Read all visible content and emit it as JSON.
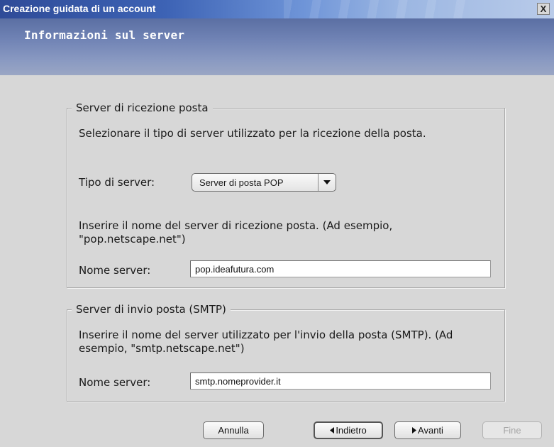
{
  "window": {
    "title": "Creazione guidata di un account",
    "close_label": "X"
  },
  "header": {
    "title": "Informazioni sul server"
  },
  "incoming": {
    "legend": "Server di ricezione posta",
    "description": "Selezionare il tipo di server utilizzato per la ricezione della posta.",
    "server_type_label": "Tipo di server:",
    "server_type_value": "Server di posta POP",
    "hint": "Inserire il nome del server di ricezione posta. (Ad esempio, \"pop.netscape.net\")",
    "server_name_label": "Nome server:",
    "server_name_value": "pop.ideafutura.com"
  },
  "outgoing": {
    "legend": "Server di invio posta (SMTP)",
    "hint": "Inserire il nome del server utilizzato per l'invio della posta (SMTP). (Ad esempio, \"smtp.netscape.net\")",
    "server_name_label": "Nome server:",
    "server_name_value": "smtp.nomeprovider.it"
  },
  "buttons": {
    "cancel": "Annulla",
    "back": "Indietro",
    "next": "Avanti",
    "finish": "Fine"
  }
}
